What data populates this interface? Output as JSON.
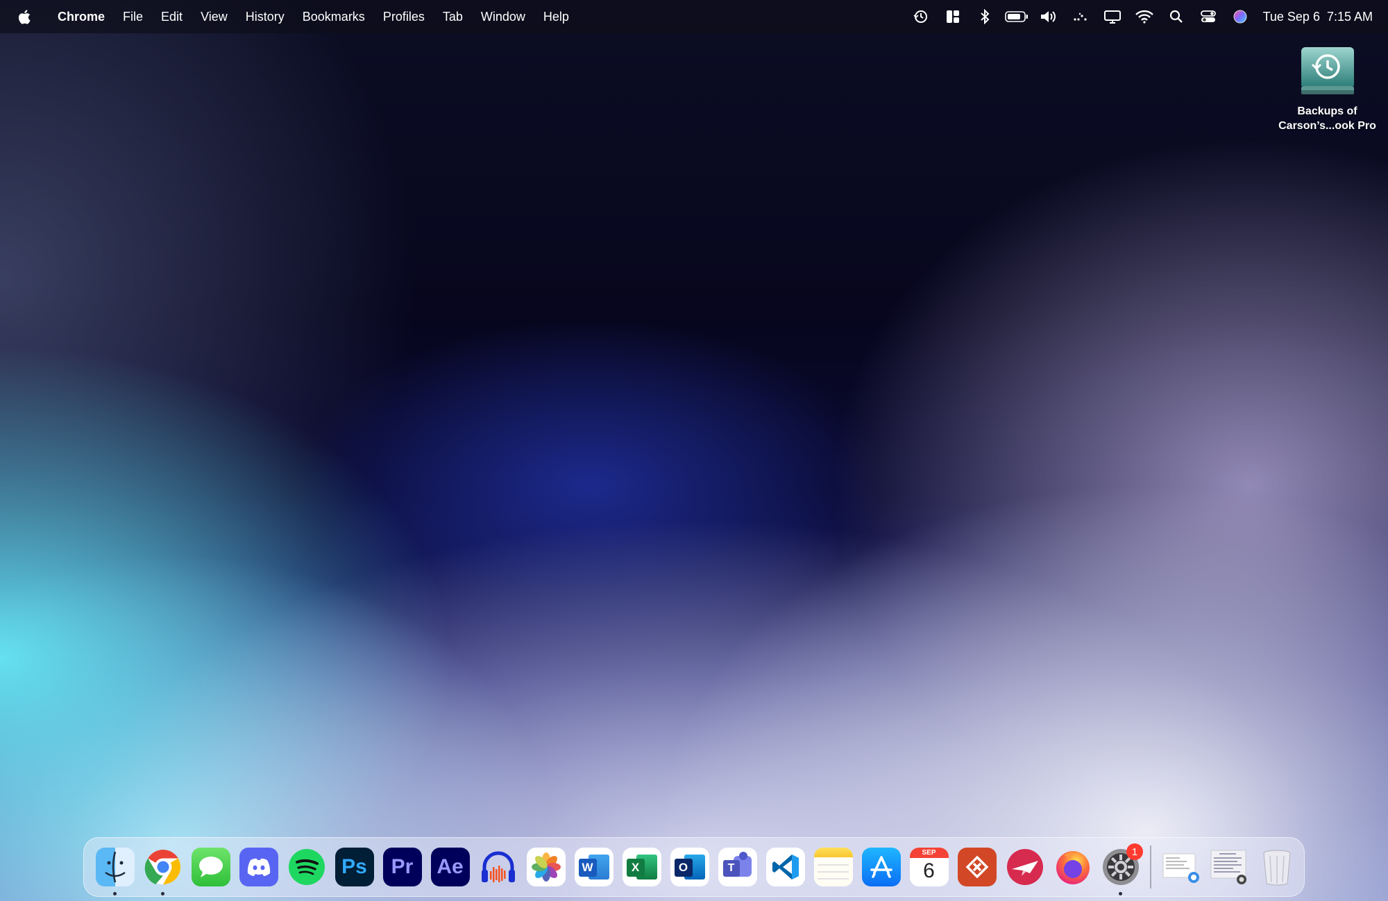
{
  "menubar": {
    "app_name": "Chrome",
    "items": [
      "File",
      "Edit",
      "View",
      "History",
      "Bookmarks",
      "Profiles",
      "Tab",
      "Window",
      "Help"
    ],
    "status_icons": [
      "time-machine-icon",
      "window-layout-icon",
      "bluetooth-icon",
      "battery-icon",
      "volume-icon",
      "wifi-sync-icon",
      "display-icon",
      "wifi-icon",
      "spotlight-search-icon",
      "control-center-icon",
      "siri-icon"
    ],
    "date": "Tue Sep 6",
    "time": "7:15 AM"
  },
  "desktop": {
    "drive_label_line1": "Backups of",
    "drive_label_line2": "Carson’s...ook Pro"
  },
  "dock": {
    "apps": [
      {
        "name": "finder",
        "running": true
      },
      {
        "name": "chrome",
        "running": true
      },
      {
        "name": "messages"
      },
      {
        "name": "discord"
      },
      {
        "name": "spotify"
      },
      {
        "name": "photoshop",
        "text": "Ps"
      },
      {
        "name": "premiere-pro",
        "text": "Pr"
      },
      {
        "name": "after-effects",
        "text": "Ae"
      },
      {
        "name": "audacity"
      },
      {
        "name": "photos"
      },
      {
        "name": "word",
        "text": "W"
      },
      {
        "name": "excel",
        "text": "X"
      },
      {
        "name": "outlook",
        "text": "O"
      },
      {
        "name": "teams",
        "text": "T"
      },
      {
        "name": "vscode"
      },
      {
        "name": "notes"
      },
      {
        "name": "app-store"
      },
      {
        "name": "calendar",
        "month": "SEP",
        "day": "6"
      },
      {
        "name": "remote-desktop"
      },
      {
        "name": "send-app"
      },
      {
        "name": "firefox"
      },
      {
        "name": "system-preferences",
        "running": true,
        "badge": "1"
      }
    ],
    "badge_system_preferences": "1",
    "calendar_month": "SEP",
    "calendar_day": "6",
    "ps_text": "Ps",
    "pr_text": "Pr",
    "ae_text": "Ae",
    "word_text": "W",
    "excel_text": "X",
    "outlook_text": "O",
    "teams_text": "T"
  },
  "colors": {
    "photoshop_bg": "#001e36",
    "photoshop_fg": "#31a8ff",
    "premiere_bg": "#00005b",
    "premiere_fg": "#9999ff",
    "aftereffects_bg": "#00005b",
    "aftereffects_fg": "#9999ff",
    "spotify": "#1ed760",
    "discord": "#5865f2",
    "badge": "#ff3b30"
  }
}
